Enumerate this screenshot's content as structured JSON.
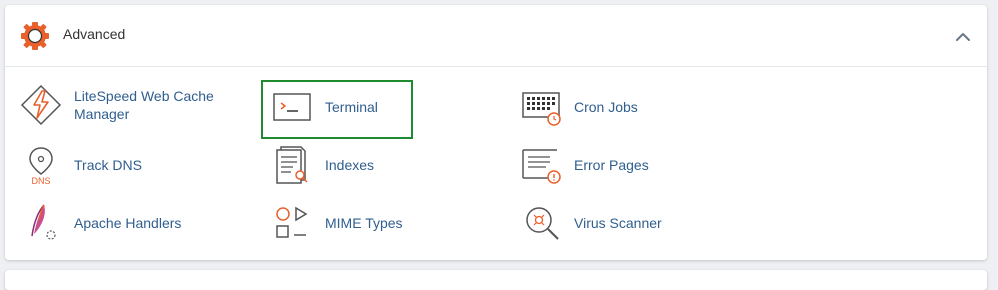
{
  "section": {
    "title": "Advanced",
    "icon": "gear-icon",
    "collapse_icon": "chevron-up-icon",
    "accent_color": "#e8602c",
    "highlight_color": "#1f8a2f"
  },
  "items": [
    {
      "label": "LiteSpeed Web Cache\nManager",
      "icon": "litespeed-icon"
    },
    {
      "label": "Terminal",
      "icon": "terminal-icon"
    },
    {
      "label": "Cron Jobs",
      "icon": "cron-calendar-icon"
    },
    {
      "label": "Track DNS",
      "icon": "dns-pin-icon",
      "icon_text": "DNS"
    },
    {
      "label": "Indexes",
      "icon": "indexes-document-icon"
    },
    {
      "label": "Error Pages",
      "icon": "error-page-icon"
    },
    {
      "label": "Apache Handlers",
      "icon": "apache-feather-icon"
    },
    {
      "label": "MIME Types",
      "icon": "mime-shapes-icon"
    },
    {
      "label": "Virus Scanner",
      "icon": "virus-scanner-icon"
    }
  ]
}
